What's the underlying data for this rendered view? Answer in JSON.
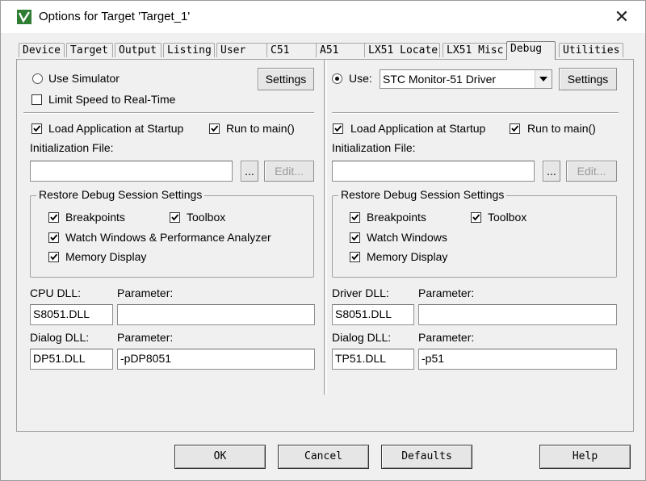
{
  "window": {
    "title": "Options for Target 'Target_1'",
    "close": "✕"
  },
  "tabs": [
    "Device",
    "Target",
    "Output",
    "Listing",
    "User",
    "C51",
    "A51",
    "LX51 Locate",
    "LX51 Misc",
    "Debug",
    "Utilities"
  ],
  "active_tab": "Debug",
  "left": {
    "use_simulator": "Use Simulator",
    "limit_speed": "Limit Speed to Real-Time",
    "settings": "Settings",
    "load_app": "Load Application at Startup",
    "run_to_main": "Run to main()",
    "init_file_label": "Initialization File:",
    "init_file_value": "",
    "browse": "...",
    "edit": "Edit...",
    "restore_title": "Restore Debug Session Settings",
    "breakpoints": "Breakpoints",
    "toolbox": "Toolbox",
    "watch": "Watch Windows & Performance Analyzer",
    "memory": "Memory Display",
    "cpu_dll_label": "CPU DLL:",
    "cpu_dll_value": "S8051.DLL",
    "param_label": "Parameter:",
    "cpu_param_value": "",
    "dialog_dll_label": "Dialog DLL:",
    "dialog_dll_value": "DP51.DLL",
    "dialog_param_value": "-pDP8051"
  },
  "right": {
    "use": "Use:",
    "driver": "STC Monitor-51 Driver",
    "settings": "Settings",
    "load_app": "Load Application at Startup",
    "run_to_main": "Run to main()",
    "init_file_label": "Initialization File:",
    "init_file_value": "",
    "browse": "...",
    "edit": "Edit...",
    "restore_title": "Restore Debug Session Settings",
    "breakpoints": "Breakpoints",
    "toolbox": "Toolbox",
    "watch": "Watch Windows",
    "memory": "Memory Display",
    "driver_dll_label": "Driver DLL:",
    "driver_dll_value": "S8051.DLL",
    "param_label": "Parameter:",
    "driver_param_value": "",
    "dialog_dll_label": "Dialog DLL:",
    "dialog_dll_value": "TP51.DLL",
    "dialog_param_value": "-p51"
  },
  "buttons": {
    "ok": "OK",
    "cancel": "Cancel",
    "defaults": "Defaults",
    "help": "Help"
  }
}
